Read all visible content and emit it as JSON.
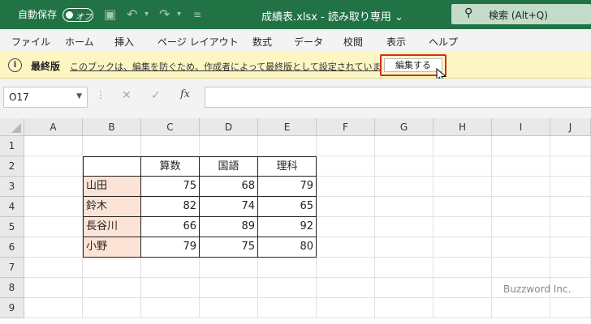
{
  "titlebar": {
    "autosave_label": "自動保存",
    "autosave_toggle": "オフ",
    "doc_title": "成績表.xlsx  -  読み取り専用",
    "search_label": "検索 (Alt+Q)",
    "bg_color": "#217346"
  },
  "menu": {
    "items": [
      "ファイル",
      "ホーム",
      "挿入",
      "ページ レイアウト",
      "数式",
      "データ",
      "校閲",
      "表示",
      "ヘルプ"
    ]
  },
  "infobar": {
    "title": "最終版",
    "message": "このブックは、編集を防ぐため、作成者によって最終版として設定されています。",
    "button_label": "編集する"
  },
  "formula_bar": {
    "name_box": "O17",
    "fx_label": "fx",
    "formula": ""
  },
  "sheet": {
    "columns": [
      "A",
      "B",
      "C",
      "D",
      "E",
      "F",
      "G",
      "H",
      "I",
      "J"
    ],
    "rows": [
      "1",
      "2",
      "3",
      "4",
      "5",
      "6",
      "7",
      "8",
      "9"
    ],
    "table": {
      "headers": [
        "",
        "算数",
        "国語",
        "理科"
      ],
      "rows": [
        {
          "name": "山田",
          "scores": [
            "75",
            "68",
            "79"
          ]
        },
        {
          "name": "鈴木",
          "scores": [
            "82",
            "74",
            "65"
          ]
        },
        {
          "name": "長谷川",
          "scores": [
            "66",
            "89",
            "92"
          ]
        },
        {
          "name": "小野",
          "scores": [
            "79",
            "75",
            "80"
          ]
        }
      ]
    },
    "name_cell_color": "#fbe3d6"
  },
  "watermark": "Buzzword Inc."
}
